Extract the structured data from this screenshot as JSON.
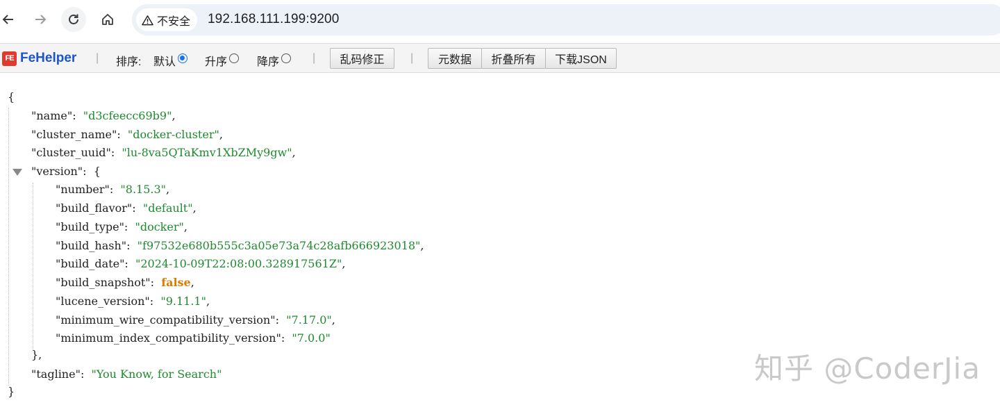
{
  "browser": {
    "security_label": "不安全",
    "url": "192.168.111.199:9200"
  },
  "fehelper": {
    "logo_mark": "FE",
    "logo_text": "FeHelper",
    "sort_label": "排序:",
    "sort_options": [
      {
        "label": "默认",
        "checked": true
      },
      {
        "label": "升序",
        "checked": false
      },
      {
        "label": "降序",
        "checked": false
      }
    ],
    "fix_encoding_label": "乱码修正",
    "metadata_label": "元数据",
    "collapse_all_label": "折叠所有",
    "download_json_label": "下载JSON",
    "separator": "|"
  },
  "json": {
    "open_brace": "{",
    "close_brace": "}",
    "name_key": "\"name\":",
    "name_val": "\"d3cfeecc69b9\"",
    "cluster_name_key": "\"cluster_name\":",
    "cluster_name_val": "\"docker-cluster\"",
    "cluster_uuid_key": "\"cluster_uuid\":",
    "cluster_uuid_val": "\"lu-8va5QTaKmv1XbZMy9gw\"",
    "version_key": "\"version\":",
    "version_open": "{",
    "version_close": "},",
    "number_key": "\"number\":",
    "number_val": "\"8.15.3\"",
    "build_flavor_key": "\"build_flavor\":",
    "build_flavor_val": "\"default\"",
    "build_type_key": "\"build_type\":",
    "build_type_val": "\"docker\"",
    "build_hash_key": "\"build_hash\":",
    "build_hash_val": "\"f97532e680b555c3a05e73a74c28afb666923018\"",
    "build_date_key": "\"build_date\":",
    "build_date_val": "\"2024-10-09T22:08:00.328917561Z\"",
    "build_snapshot_key": "\"build_snapshot\":",
    "build_snapshot_val": "false",
    "lucene_version_key": "\"lucene_version\":",
    "lucene_version_val": "\"9.11.1\"",
    "min_wire_key": "\"minimum_wire_compatibility_version\":",
    "min_wire_val": "\"7.17.0\"",
    "min_index_key": "\"minimum_index_compatibility_version\":",
    "min_index_val": "\"7.0.0\"",
    "tagline_key": "\"tagline\":",
    "tagline_val": "\"You Know, for Search\"",
    "comma": ","
  },
  "watermark": "知乎 @CoderJia"
}
